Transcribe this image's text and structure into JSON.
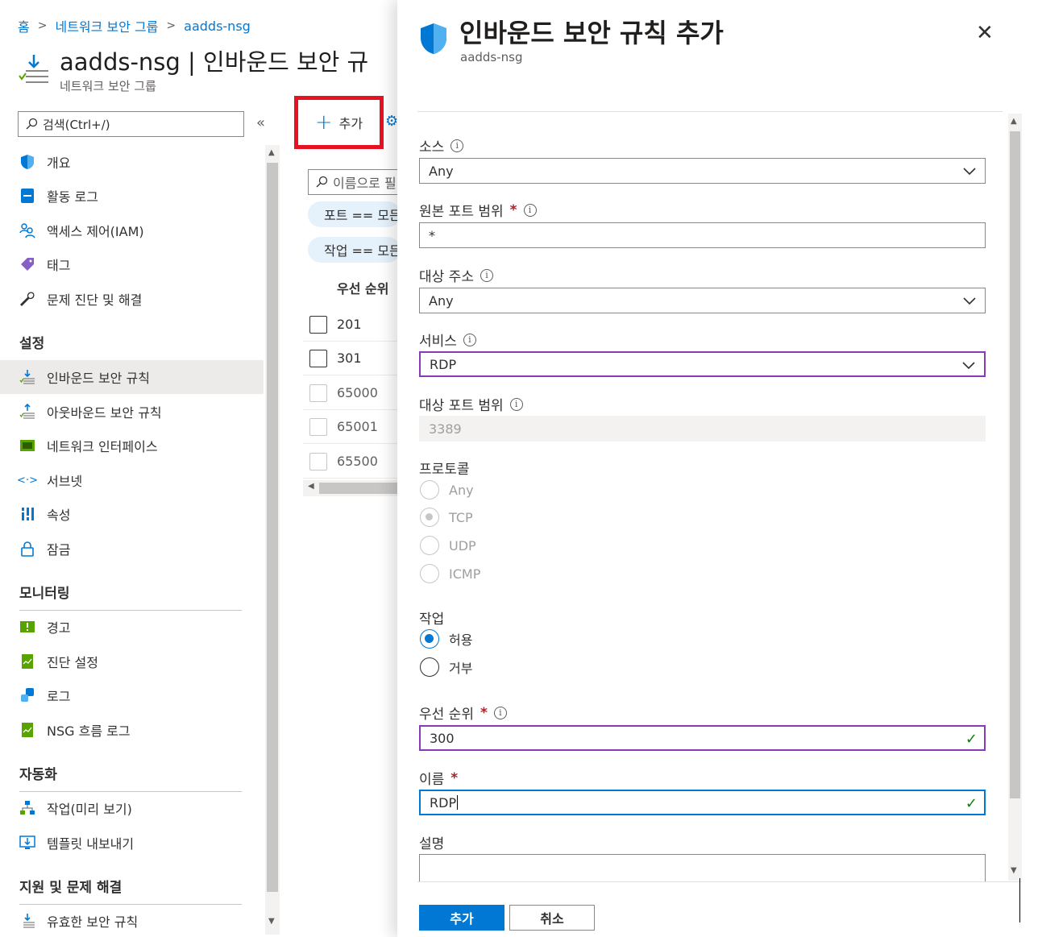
{
  "breadcrumb": [
    "홈",
    "네트워크 보안 그룹",
    "aadds-nsg"
  ],
  "page": {
    "title": "aadds-nsg | 인바운드 보안 규",
    "subtitle": "네트워크 보안 그룹"
  },
  "sidebar": {
    "search_placeholder": "검색(Ctrl+/)",
    "collapse": "«",
    "items_top": [
      {
        "label": "개요",
        "icon": "shield-icon"
      },
      {
        "label": "활동 로그",
        "icon": "activity-log-icon"
      },
      {
        "label": "액세스 제어(IAM)",
        "icon": "people-icon"
      },
      {
        "label": "태그",
        "icon": "tag-icon"
      },
      {
        "label": "문제 진단 및 해결",
        "icon": "wrench-icon"
      }
    ],
    "section_settings": "설정",
    "items_settings": [
      {
        "label": "인바운드 보안 규칙",
        "icon": "inbound-icon",
        "active": true
      },
      {
        "label": "아웃바운드 보안 규칙",
        "icon": "outbound-icon"
      },
      {
        "label": "네트워크 인터페이스",
        "icon": "nic-icon"
      },
      {
        "label": "서브넷",
        "icon": "subnet-icon"
      },
      {
        "label": "속성",
        "icon": "properties-icon"
      },
      {
        "label": "잠금",
        "icon": "lock-icon"
      }
    ],
    "section_monitoring": "모니터링",
    "items_monitoring": [
      {
        "label": "경고",
        "icon": "alert-icon"
      },
      {
        "label": "진단 설정",
        "icon": "diagnostic-icon"
      },
      {
        "label": "로그",
        "icon": "logs-icon"
      },
      {
        "label": "NSG 흐름 로그",
        "icon": "flowlog-icon"
      }
    ],
    "section_automation": "자동화",
    "items_automation": [
      {
        "label": "작업(미리 보기)",
        "icon": "tasks-icon"
      },
      {
        "label": "템플릿 내보내기",
        "icon": "export-template-icon"
      }
    ],
    "section_support": "지원 및 문제 해결",
    "items_support": [
      {
        "label": "유효한 보안 규칙",
        "icon": "effective-rules-icon"
      }
    ]
  },
  "middle": {
    "add_label": "추가",
    "search_placeholder": "이름으로 필",
    "filter_port": "포트 == 모든",
    "filter_action": "작업 == 모든",
    "column_priority": "우선 순위",
    "rows": [
      "201",
      "301",
      "65000",
      "65001",
      "65500"
    ]
  },
  "panel": {
    "title": "인바운드 보안 규칙 추가",
    "subtitle": "aadds-nsg",
    "source_label": "소스",
    "source_value": "Any",
    "source_port_label": "원본 포트 범위",
    "source_port_value": "*",
    "dest_label": "대상 주소",
    "dest_value": "Any",
    "service_label": "서비스",
    "service_value": "RDP",
    "dest_port_label": "대상 포트 범위",
    "dest_port_value": "3389",
    "protocol_label": "프로토콜",
    "protocols": [
      "Any",
      "TCP",
      "UDP",
      "ICMP"
    ],
    "protocol_selected": "TCP",
    "action_label": "작업",
    "actions": [
      "허용",
      "거부"
    ],
    "action_selected": "허용",
    "priority_label": "우선 순위",
    "priority_value": "300",
    "name_label": "이름",
    "name_value": "RDP",
    "description_label": "설명",
    "required_mark": "*",
    "info_glyph": "i",
    "add_button": "추가",
    "cancel_button": "취소"
  },
  "colors": {
    "accent": "#0078d4",
    "highlight_box": "#e81123",
    "valid_border": "#8a3ab9",
    "check": "#107c10"
  }
}
